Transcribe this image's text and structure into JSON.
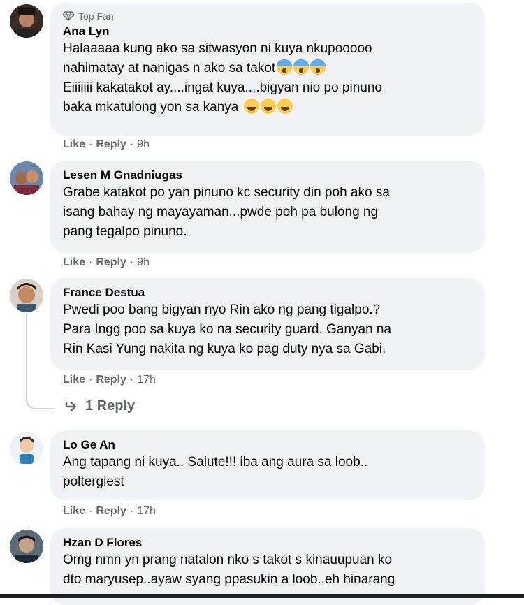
{
  "comments": [
    {
      "badge": "Top Fan",
      "author": "Ana Lyn",
      "lines": [
        "Halaaaaa kung ako sa sitwasyon ni kuya nkupooooo",
        "nahimatay at nanigas n ako sa takot",
        "Eiiiiiii kakatakot ay....ingat kuya....bigyan nio po pinuno",
        "baka mkatulong yon sa kanya"
      ],
      "like": "Like",
      "reply": "Reply",
      "time": "9h"
    },
    {
      "author": "Lesen M Gnadniugas",
      "lines": [
        "Grabe katakot po yan pinuno kc security din poh ako sa",
        "isang bahay ng mayayaman...pwde poh pa bulong ng",
        "pang tegalpo pinuno."
      ],
      "like": "Like",
      "reply": "Reply",
      "time": "9h"
    },
    {
      "author": "France Destua",
      "lines": [
        "Pwedi poo bang bigyan nyo Rin ako ng pang tigalpo.?",
        "Para Ingg poo sa kuya ko na security guard. Ganyan na",
        "Rin Kasi Yung nakita ng kuya ko pag duty nya sa Gabi."
      ],
      "like": "Like",
      "reply": "Reply",
      "time": "17h",
      "replies_link": "1 Reply"
    },
    {
      "author": "Lo Ge An",
      "lines": [
        "Ang tapang ni kuya.. Salute!!! iba ang aura sa loob..",
        "poltergiest"
      ],
      "like": "Like",
      "reply": "Reply",
      "time": "17h"
    },
    {
      "author": "Hzan D Flores",
      "lines": [
        "Omg nmn yn prang natalon nko s takot s kinauupuan ko",
        "dto maryusep..ayaw syang ppasukin a loob..eh hinarang"
      ]
    }
  ],
  "icons": {
    "badge": "diamond-icon",
    "reply_arrow": "reply-arrow-icon",
    "emoji_scream": "face-screaming-in-fear-emoji",
    "emoji_tired": "tired-face-emoji"
  }
}
